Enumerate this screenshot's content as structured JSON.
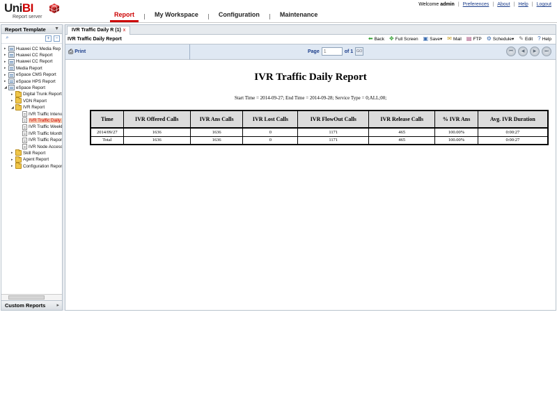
{
  "app": {
    "logo_word": "UniBI",
    "logo_sub": "Report server"
  },
  "nav": {
    "tabs": [
      "Report",
      "My Workspace",
      "Configuration",
      "Maintenance"
    ],
    "active": "Report"
  },
  "toplinks": {
    "welcome_prefix": "Welcome",
    "user": "admin",
    "preferences": "Preferences",
    "about": "About",
    "help": "Help",
    "logout": "Logout"
  },
  "left": {
    "header": "Report Template",
    "footer": "Custom Reports",
    "tree": [
      {
        "label": "Huawei CC Media Rep",
        "level": 0,
        "icon": "rep",
        "arrow": "▸"
      },
      {
        "label": "Huawei CC Report",
        "level": 0,
        "icon": "rep",
        "arrow": "▸"
      },
      {
        "label": "Huawei CC Report",
        "level": 0,
        "icon": "rep",
        "arrow": "▸"
      },
      {
        "label": "Media Report",
        "level": 0,
        "icon": "rep",
        "arrow": "▸"
      },
      {
        "label": "eSpace CMS  Report",
        "level": 0,
        "icon": "rep",
        "arrow": "▸"
      },
      {
        "label": "eSpace HPS Report",
        "level": 0,
        "icon": "rep",
        "arrow": "▸"
      },
      {
        "label": "eSpace Report",
        "level": 0,
        "icon": "rep",
        "arrow": "◢"
      },
      {
        "label": "Digital Trunk Report",
        "level": 1,
        "icon": "fold",
        "arrow": "▸"
      },
      {
        "label": "VDN Report",
        "level": 1,
        "icon": "fold",
        "arrow": "▸"
      },
      {
        "label": "IVR Report",
        "level": 1,
        "icon": "fold",
        "arrow": "◢"
      },
      {
        "label": "IVR Traffic Interval",
        "level": 2,
        "icon": "doc",
        "arrow": ""
      },
      {
        "label": "IVR Traffic Daily R",
        "level": 2,
        "icon": "doc",
        "arrow": "",
        "selected": true
      },
      {
        "label": "IVR Traffic Weekly",
        "level": 2,
        "icon": "doc",
        "arrow": ""
      },
      {
        "label": "IVR Traffic Monthly",
        "level": 2,
        "icon": "doc",
        "arrow": ""
      },
      {
        "label": "IVR Traffic Report",
        "level": 2,
        "icon": "doc",
        "arrow": ""
      },
      {
        "label": "IVR Node Access",
        "level": 2,
        "icon": "doc",
        "arrow": ""
      },
      {
        "label": "Skill Report",
        "level": 1,
        "icon": "fold",
        "arrow": "▸"
      },
      {
        "label": "Agent Report",
        "level": 1,
        "icon": "fold",
        "arrow": "▸"
      },
      {
        "label": "Configuration Report",
        "level": 1,
        "icon": "fold",
        "arrow": "▸"
      }
    ]
  },
  "main": {
    "doc_tab": "IVR Traffic Daily R (1)",
    "doc_tab_close": "x",
    "toolbar_title": "IVR Traffic Daily Report",
    "tools": [
      {
        "name": "back",
        "label": "Back",
        "icon": "back-arrow-icon",
        "glyph": "⬅",
        "color": "#2e9c2e"
      },
      {
        "name": "full-screen",
        "label": "Full Screen",
        "icon": "fullscreen-icon",
        "glyph": "✥",
        "color": "#2e9c2e"
      },
      {
        "name": "save",
        "label": "Save▾",
        "icon": "save-icon",
        "glyph": "▣",
        "color": "#3a6cb0"
      },
      {
        "name": "mail",
        "label": "Mail",
        "icon": "mail-icon",
        "glyph": "✉",
        "color": "#c8a028"
      },
      {
        "name": "ftp",
        "label": "FTP",
        "icon": "ftp-icon",
        "glyph": "▤",
        "color": "#a04070"
      },
      {
        "name": "schedule",
        "label": "Schedule▾",
        "icon": "schedule-icon",
        "glyph": "⚙",
        "color": "#3a6cb0"
      },
      {
        "name": "edit",
        "label": "Edit",
        "icon": "edit-icon",
        "glyph": "✎",
        "color": "#6a6a6a"
      },
      {
        "name": "help",
        "label": "Help",
        "icon": "help-icon",
        "glyph": "?",
        "color": "#3a6cb0"
      }
    ],
    "print": "Print",
    "pager": {
      "page_label": "Page",
      "page_value": "1",
      "of_label": "of 1",
      "go_label": "GO"
    }
  },
  "report": {
    "title": "IVR Traffic Daily Report",
    "subtitle": "Start Time = 2014-09-27; End Time = 2014-09-28; Service Type = 0;ALL;00;",
    "columns": [
      "Time",
      "IVR Offered Calls",
      "IVR Ans Calls",
      "IVR Lost Calls",
      "IVR FlowOut Calls",
      "IVR Release Calls",
      "% IVR Ans",
      "Avg. IVR Duration"
    ],
    "rows": [
      [
        "2014/09/27",
        "1636",
        "1636",
        "0",
        "1171",
        "465",
        "100.00%",
        "0:00:27"
      ],
      [
        "Total",
        "1636",
        "1636",
        "0",
        "1171",
        "465",
        "100.00%",
        "0:00:27"
      ]
    ]
  }
}
